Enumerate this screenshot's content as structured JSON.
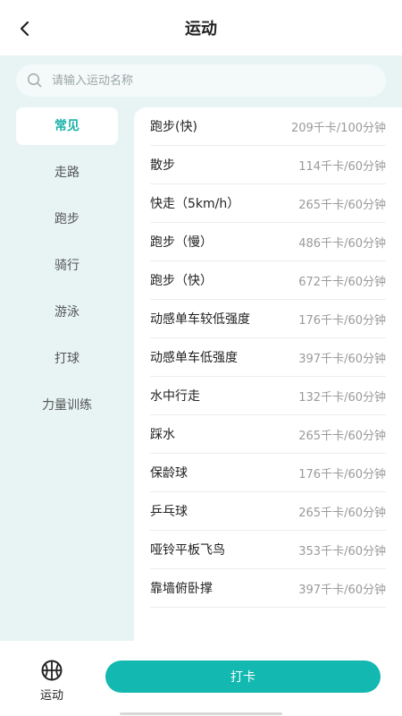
{
  "header": {
    "title": "运动",
    "back_icon": "chevron-left-icon"
  },
  "search": {
    "placeholder": "请输入运动名称",
    "value": ""
  },
  "sidebar": {
    "items": [
      {
        "label": "常见",
        "active": true
      },
      {
        "label": "走路"
      },
      {
        "label": "跑步"
      },
      {
        "label": "骑行"
      },
      {
        "label": "游泳"
      },
      {
        "label": "打球"
      },
      {
        "label": "力量训练"
      }
    ]
  },
  "activities": [
    {
      "name": "跑步(快)",
      "calories": "209千卡/100分钟"
    },
    {
      "name": "散步",
      "calories": "114千卡/60分钟"
    },
    {
      "name": "快走（5km/h）",
      "calories": "265千卡/60分钟"
    },
    {
      "name": "跑步（慢）",
      "calories": "486千卡/60分钟"
    },
    {
      "name": "跑步（快）",
      "calories": "672千卡/60分钟"
    },
    {
      "name": "动感单车较低强度",
      "calories": "176千卡/60分钟"
    },
    {
      "name": "动感单车低强度",
      "calories": "397千卡/60分钟"
    },
    {
      "name": "水中行走",
      "calories": "132千卡/60分钟"
    },
    {
      "name": "踩水",
      "calories": "265千卡/60分钟"
    },
    {
      "name": "保龄球",
      "calories": "176千卡/60分钟"
    },
    {
      "name": "乒乓球",
      "calories": "265千卡/60分钟"
    },
    {
      "name": "哑铃平板飞鸟",
      "calories": "353千卡/60分钟"
    },
    {
      "name": "靠墙俯卧撑",
      "calories": "397千卡/60分钟"
    }
  ],
  "bottom_bar": {
    "tab_label": "运动",
    "tab_icon": "basketball-icon",
    "checkin_label": "打卡"
  },
  "colors": {
    "accent": "#13b8b0",
    "background": "#e8f4f4"
  }
}
